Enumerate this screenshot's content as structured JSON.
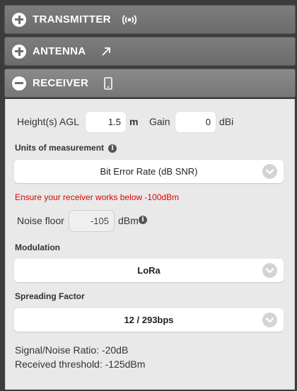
{
  "accordion": {
    "transmitter": {
      "title": "TRANSMITTER",
      "icon": "broadcast-icon",
      "expanded": false
    },
    "antenna": {
      "title": "ANTENNA",
      "icon": "arrow-up-right-icon",
      "expanded": false
    },
    "receiver": {
      "title": "RECEIVER",
      "icon": "phone-icon",
      "expanded": true
    }
  },
  "receiver": {
    "height_label": "Height(s) AGL",
    "height_value": "1.5",
    "height_unit": "m",
    "gain_label": "Gain",
    "gain_value": "0",
    "gain_unit": "dBi",
    "units_label": "Units of measurement",
    "units_selected": "Bit Error Rate (dB SNR)",
    "warning": "Ensure your receiver works below -100dBm",
    "noise_floor_label": "Noise floor",
    "noise_floor_value": "-105",
    "noise_floor_unit": "dBm",
    "modulation_label": "Modulation",
    "modulation_selected": "LoRa",
    "spreading_factor_label": "Spreading Factor",
    "spreading_factor_selected": "12 / 293bps",
    "snr_text": "Signal/Noise Ratio: -20dB",
    "threshold_text": "Received threshold: -125dBm"
  },
  "colors": {
    "header": "#727272",
    "body": "#e9e9e9",
    "warning": "#e00000",
    "background": "#3c3c3c"
  }
}
